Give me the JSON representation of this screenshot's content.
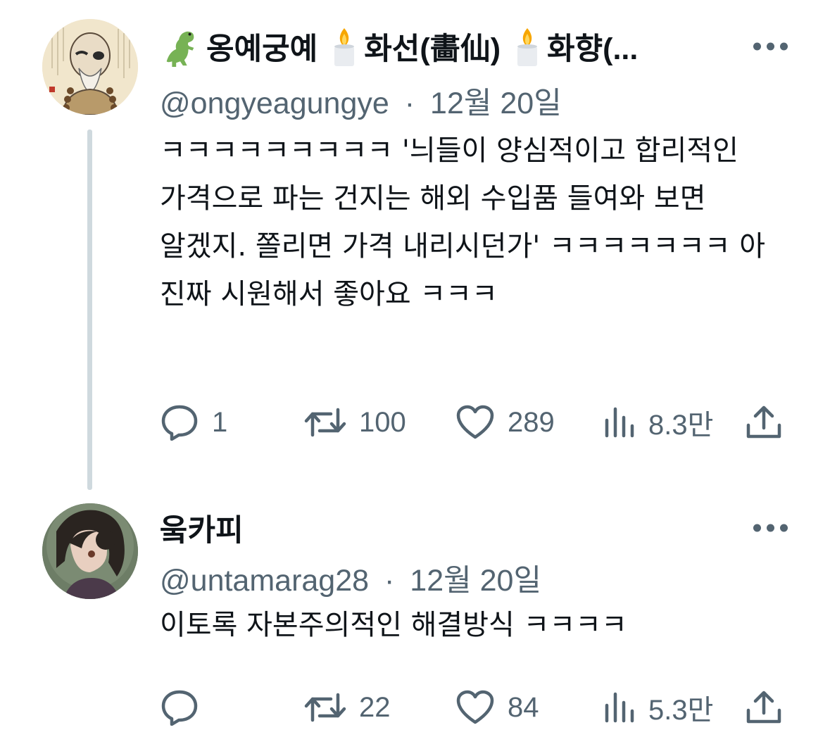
{
  "tweets": [
    {
      "display_name_parts": [
        "옹예궁예",
        "화선(畵仙)",
        "화향(..."
      ],
      "name_emojis": [
        "dinosaur-emoji",
        "candle-emoji",
        "candle-emoji"
      ],
      "handle": "@ongyeagungye",
      "separator": "·",
      "date": "12월 20일",
      "text": "ㅋㅋㅋㅋㅋㅋㅋㅋㅋ '늬들이 양심적이고 합리적인 가격으로 파는 건지는 해외 수입품 들여와 보면 알겠지. 쫄리면 가격 내리시던가' ㅋㅋㅋㅋㅋㅋㅋ 아 진짜 시원해서 좋아요 ㅋㅋㅋ",
      "replies": "1",
      "retweets": "100",
      "likes": "289",
      "views": "8.3만"
    },
    {
      "display_name": "웈카피",
      "handle": "@untamarag28",
      "separator": "·",
      "date": "12월 20일",
      "text": "이토록 자본주의적인 해결방식 ㅋㅋㅋㅋ",
      "replies": "",
      "retweets": "22",
      "likes": "84",
      "views": "5.3만"
    }
  ],
  "colors": {
    "text_primary": "#0f1419",
    "text_secondary": "#536471",
    "thread_line": "#cfd9de",
    "background": "#ffffff"
  },
  "icons": [
    "reply-icon",
    "retweet-icon",
    "like-icon",
    "views-icon",
    "share-icon",
    "more-icon"
  ]
}
